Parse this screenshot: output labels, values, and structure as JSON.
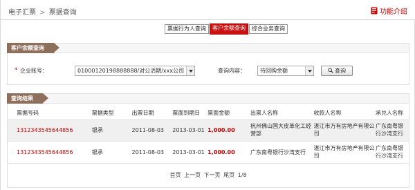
{
  "breadcrumb": {
    "level1": "电子汇票",
    "separator": ">",
    "level2": "票据查询"
  },
  "header": {
    "func_intro_label": "功能介绍"
  },
  "tabs": [
    {
      "label": "票据行为人查询",
      "active": false
    },
    {
      "label": "客户余额查询",
      "active": true
    },
    {
      "label": "综合业务查询",
      "active": false
    }
  ],
  "query_panel": {
    "title": "客户余额查询",
    "required_mark": "*",
    "account_label": "企业账号：",
    "account_value": "01000120198888888/对公活期/xxx公司",
    "content_label": "查询内容：",
    "content_value": "待回购余额",
    "query_button": "查询"
  },
  "result_panel": {
    "title": "查询结果",
    "columns": [
      "票据号码",
      "票据类型",
      "出票日期",
      "票面到期日",
      "票面金额",
      "出票人名称",
      "收款人名称",
      "承兑人名称"
    ],
    "rows": [
      {
        "bill_no": "1312343545644856",
        "bill_type": "银承",
        "issue_date": "2011-08-03",
        "due_date": "2013-03-01",
        "amount": "1,000.00",
        "drawer": "杭州佛山国大皮革化工经营部",
        "payee": "湛江市万有房地产有限公司",
        "acceptor": "广东南粤银行沙湾支行"
      },
      {
        "bill_no": "1312343545644856",
        "bill_type": "银承",
        "issue_date": "2011-08-03",
        "due_date": "2013-03-01",
        "amount": "1,000.00",
        "drawer": "广东南粤银行沙湾支行",
        "payee": "湛江市万有房地产有限公司",
        "acceptor": "广东南粤银行沙湾支行"
      }
    ],
    "pager": {
      "first": "首页",
      "prev": "上一页",
      "next": "下一页",
      "last": "尾页",
      "page_info": "1/8"
    }
  },
  "colors": {
    "accent_red": "#cc1111",
    "ribbon_brown": "#8e6f5c",
    "row_alt": "#f0f0f0"
  },
  "icons": {
    "func_intro": "book-icon",
    "query_button": "magnifier-icon",
    "dropdown": "chevron-down-icon"
  }
}
